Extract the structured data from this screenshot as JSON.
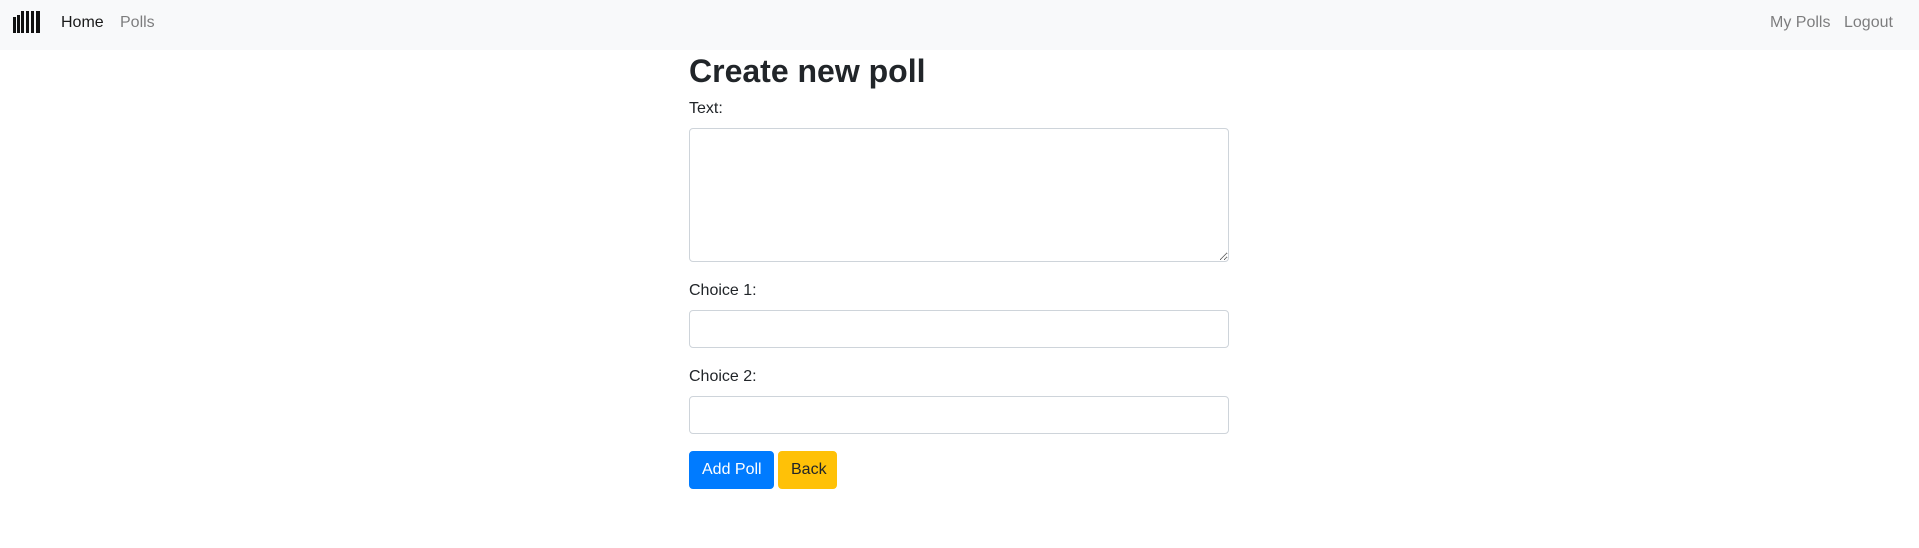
{
  "colors": {
    "navbar_bg": "#f8f9fa",
    "primary": "#007bff",
    "warning": "#ffc107",
    "text": "#212529",
    "input_border": "#ced4da"
  },
  "navbar": {
    "brand_icon": "logo-icon",
    "links_left": [
      {
        "label": "Home",
        "active": true
      },
      {
        "label": "Polls",
        "active": false
      }
    ],
    "links_right": [
      {
        "label": "My Polls"
      },
      {
        "label": "Logout"
      }
    ]
  },
  "form": {
    "title": "Create new poll",
    "text_label": "Text:",
    "text_value": "",
    "choice_1_label": "Choice 1:",
    "choice_1_value": "",
    "choice_2_label": "Choice 2:",
    "choice_2_value": "",
    "submit_label": "Add Poll",
    "back_label": "Back"
  }
}
